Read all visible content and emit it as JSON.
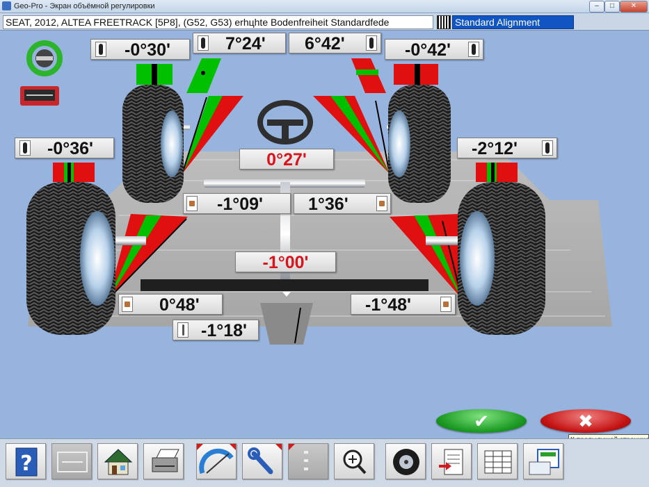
{
  "window": {
    "title": "Geo-Pro  -  Экран объёмной регулировки",
    "controls": {
      "minimize": "–",
      "maximize": "□",
      "close": "✕"
    }
  },
  "vehicle_info": "SEAT, 2012, ALTEA FREETRACK [5P8], (G52, G53) erhцhte Bodenfreiheit Standardfede",
  "alignment_mode": "Standard Alignment",
  "readings": {
    "front_left_camber": "-0°30'",
    "front_left_toe": "7°24'",
    "front_right_toe": "6°42'",
    "front_right_camber": "-0°42'",
    "rear_left_camber": "-0°36'",
    "rear_right_camber": "-2°12'",
    "front_total_toe": "0°27'",
    "front_left_caster": "-1°09'",
    "front_right_caster": "1°36'",
    "rear_total_toe": "-1°00'",
    "rear_left_toe": "0°48'",
    "rear_right_toe": "-1°48'",
    "thrust_angle": "-1°18'"
  },
  "actions": {
    "ok_symbol": "✔",
    "cancel_symbol": "✖"
  },
  "tooltip": "К предыдущей странице",
  "colors": {
    "in_tolerance": "#00c000",
    "out_of_tolerance": "#e01010",
    "background": "#97b4de",
    "highlight_value": "#d8141c"
  },
  "toolbar": [
    {
      "icon": "help-icon"
    },
    {
      "icon": "blank-screen-icon",
      "disabled": true
    },
    {
      "icon": "home-icon"
    },
    {
      "icon": "printer-icon"
    },
    {
      "icon": "protractor-icon"
    },
    {
      "icon": "wrench-icon"
    },
    {
      "icon": "steps-icon",
      "disabled": true
    },
    {
      "icon": "zoom-in-icon"
    },
    {
      "icon": "wheel-icon"
    },
    {
      "icon": "report-icon"
    },
    {
      "icon": "database-icon"
    },
    {
      "icon": "previous-page-icon"
    }
  ]
}
